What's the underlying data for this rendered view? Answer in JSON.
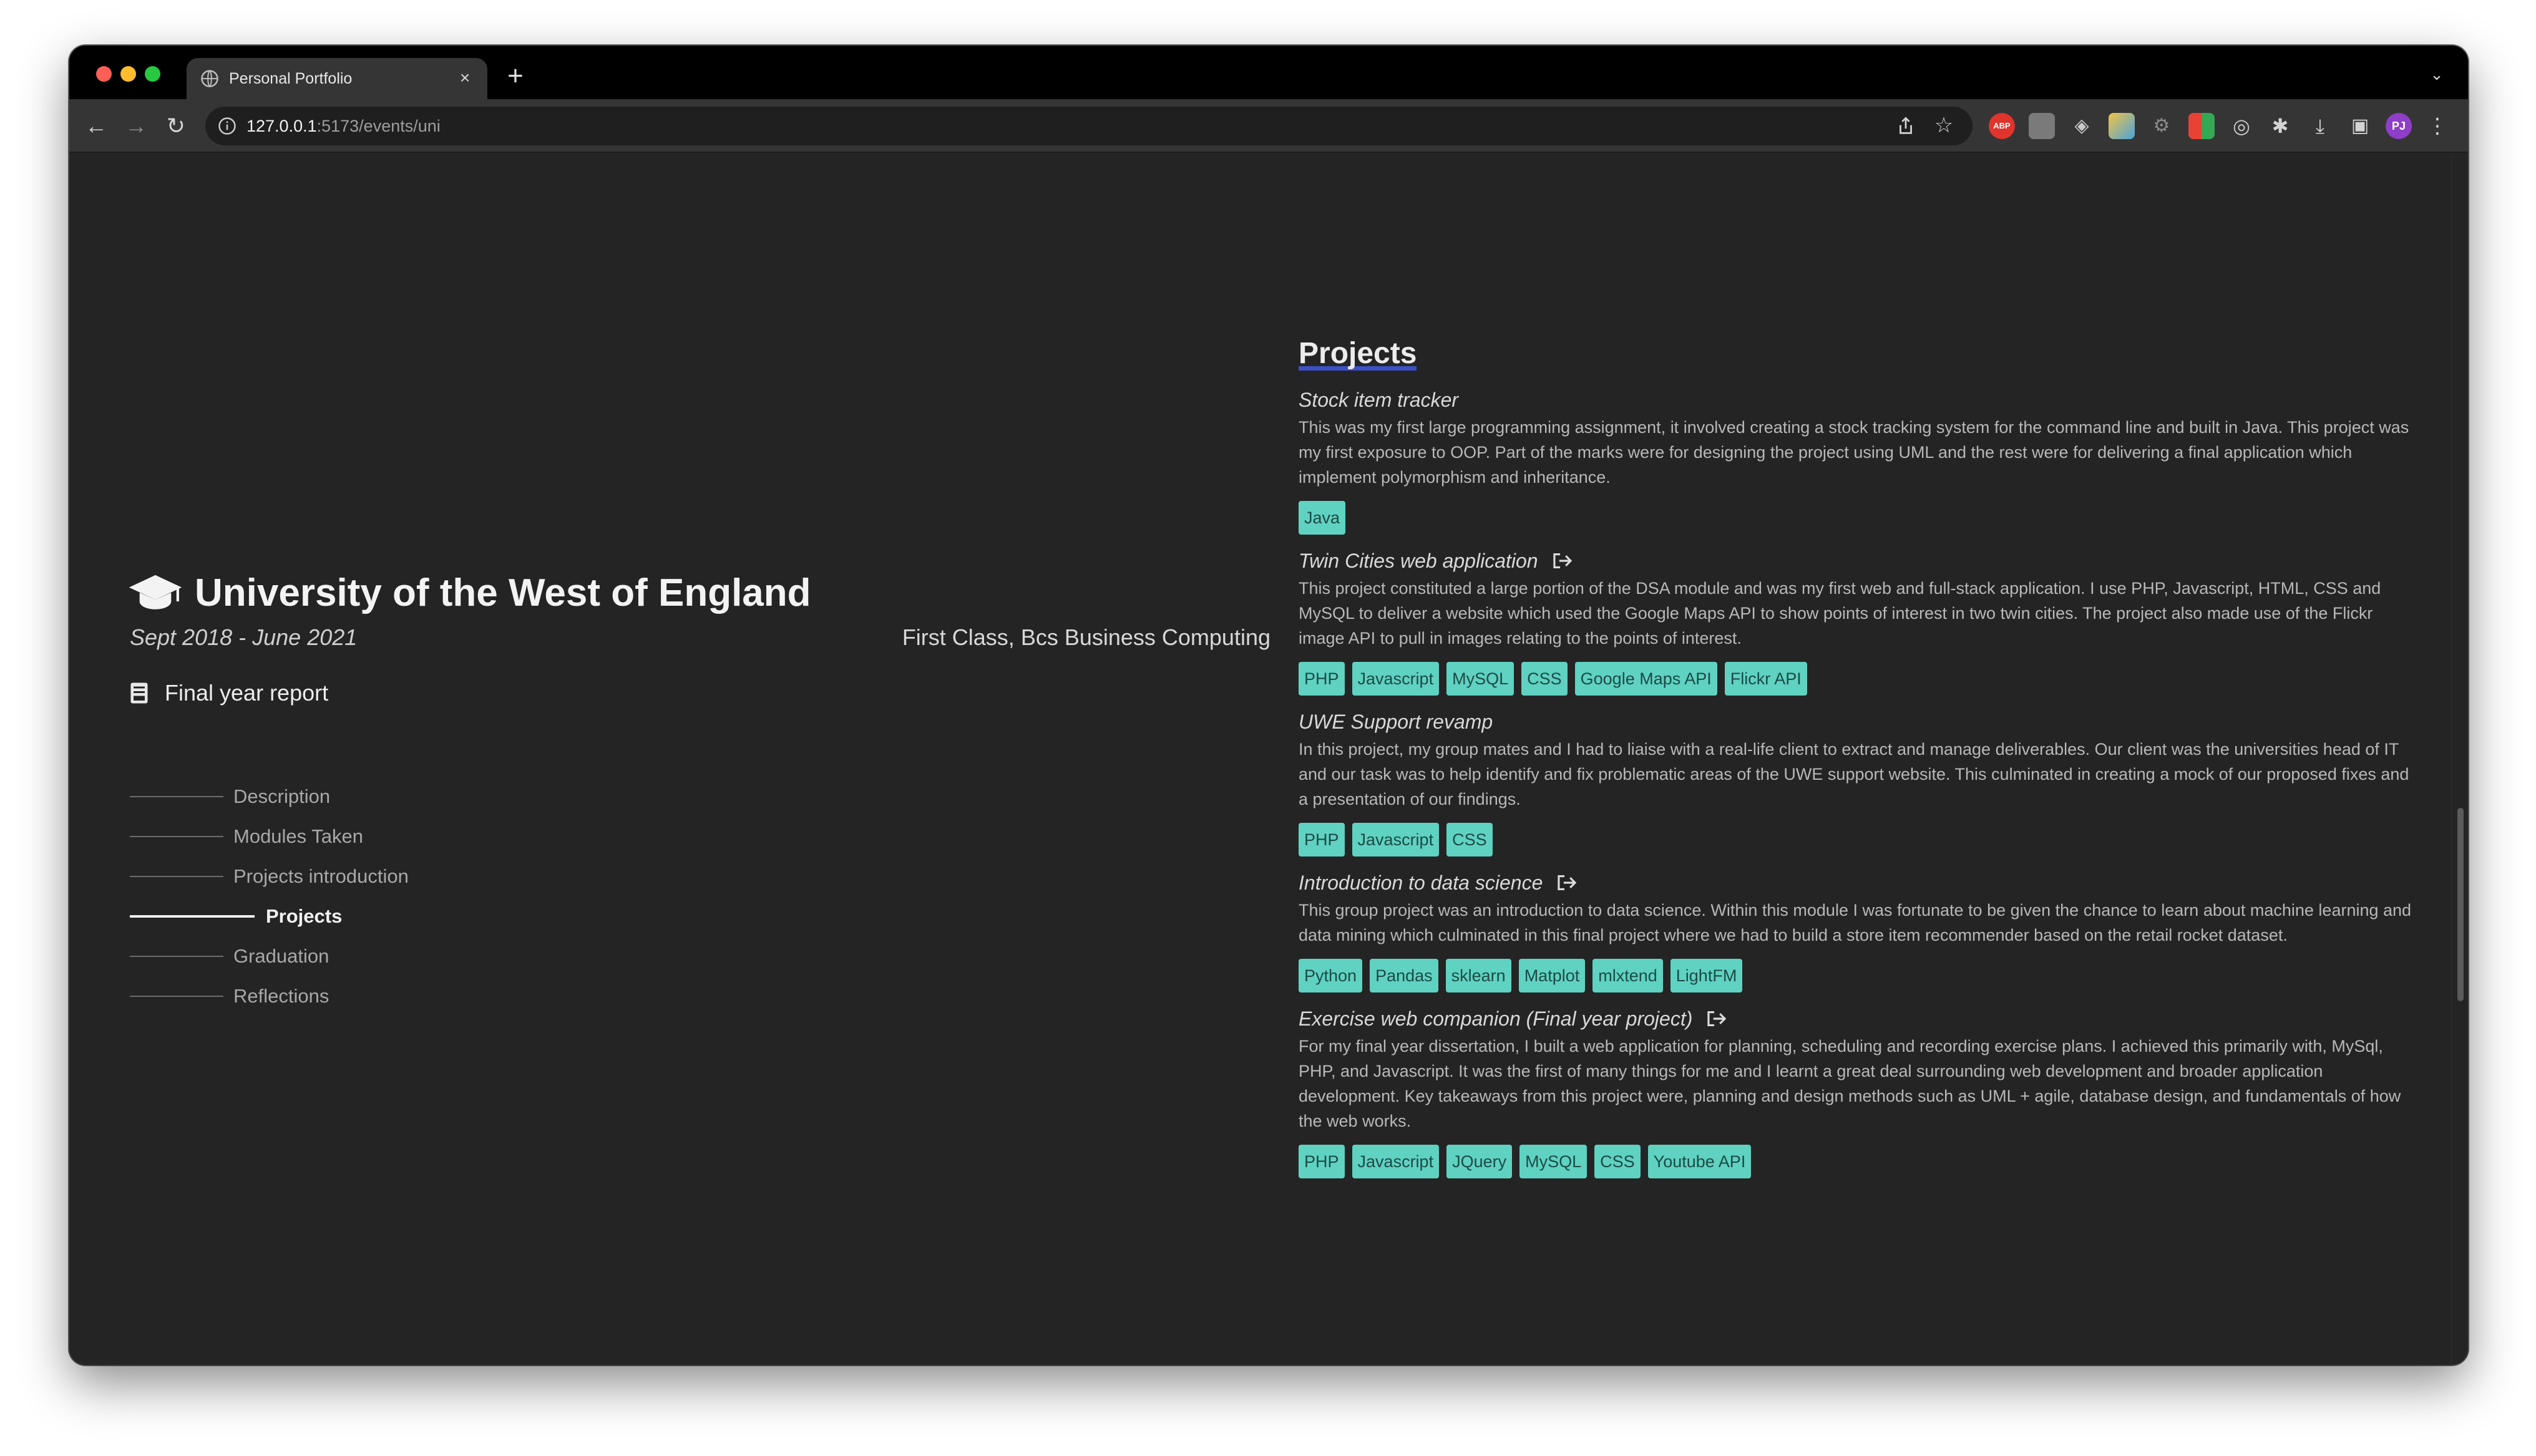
{
  "browser": {
    "tab_title": "Personal Portfolio",
    "close_glyph": "×",
    "new_tab_glyph": "+",
    "url_host": "127.0.0.1",
    "url_rest": ":5173/events/uni",
    "avatar_initials": "PJ",
    "adblock_label": "ABP",
    "icons": [
      "back-icon",
      "forward-icon",
      "reload-icon",
      "info-icon",
      "share-icon",
      "star-icon",
      "extensions-puzzle-icon",
      "download-icon",
      "sidepanel-icon",
      "menu-kebab-icon"
    ]
  },
  "page": {
    "institution": "University of the West of England",
    "dates": "Sept 2018 - June 2021",
    "degree": "First Class, Bcs Business Computing",
    "report_link": "Final year report",
    "toc": [
      {
        "label": "Description"
      },
      {
        "label": "Modules Taken"
      },
      {
        "label": "Projects introduction"
      },
      {
        "label": "Projects"
      },
      {
        "label": "Graduation"
      },
      {
        "label": "Reflections"
      }
    ],
    "active_toc": "Projects",
    "section_title": "Projects",
    "accent_color": "#3d4fc9",
    "tag_color": "#5fd2c2",
    "projects": [
      {
        "title": "Stock item tracker",
        "has_link": false,
        "description": "This was my first large programming assignment, it involved creating a stock tracking system for the command line and built in Java. This project was my first exposure to OOP. Part of the marks were for designing the project using UML and the rest were for delivering a final application which implement polymorphism and inheritance.",
        "tags": [
          "Java"
        ]
      },
      {
        "title": "Twin Cities web application",
        "has_link": true,
        "description": "This project constituted a large portion of the DSA module and was my first web and full-stack application. I use PHP, Javascript, HTML, CSS and MySQL to deliver a website which used the Google Maps API to show points of interest in two twin cities. The project also made use of the Flickr image API to pull in images relating to the points of interest.",
        "tags": [
          "PHP",
          "Javascript",
          "MySQL",
          "CSS",
          "Google Maps API",
          "Flickr API"
        ]
      },
      {
        "title": "UWE Support revamp",
        "has_link": false,
        "description": "In this project, my group mates and I had to liaise with a real-life client to extract and manage deliverables. Our client was the universities head of IT and our task was to help identify and fix problematic areas of the UWE support website. This culminated in creating a mock of our proposed fixes and a presentation of our findings.",
        "tags": [
          "PHP",
          "Javascript",
          "CSS"
        ]
      },
      {
        "title": "Introduction to data science",
        "has_link": true,
        "description": "This group project was an introduction to data science. Within this module I was fortunate to be given the chance to learn about machine learning and data mining which culminated in this final project where we had to build a store item recommender based on the retail rocket dataset.",
        "tags": [
          "Python",
          "Pandas",
          "sklearn",
          "Matplot",
          "mlxtend",
          "LightFM"
        ]
      },
      {
        "title": "Exercise web companion (Final year project)",
        "has_link": true,
        "description": "For my final year dissertation, I built a web application for planning, scheduling and recording exercise plans. I achieved this primarily with, MySql, PHP, and Javascript. It was the first of many things for me and I learnt a great deal surrounding web development and broader application development. Key takeaways from this project were, planning and design methods such as UML + agile, database design, and fundamentals of how the web works.",
        "tags": [
          "PHP",
          "Javascript",
          "JQuery",
          "MySQL",
          "CSS",
          "Youtube API"
        ]
      }
    ]
  }
}
